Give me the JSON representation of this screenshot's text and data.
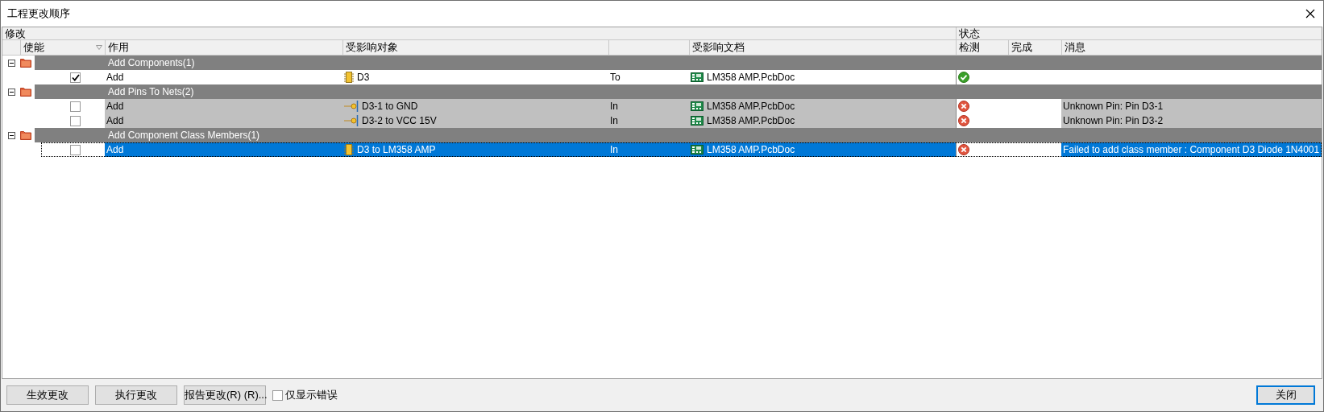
{
  "window": {
    "title": "工程更改顺序"
  },
  "header_groups": {
    "modify": "修改",
    "status": "状态"
  },
  "columns": {
    "enable": "使能",
    "action": "作用",
    "object": "受影响对象",
    "document": "受影响文档",
    "check": "检测",
    "done": "完成",
    "message": "消息"
  },
  "groups": [
    {
      "label": "Add Components(1)",
      "expanded": true,
      "items": [
        {
          "kind": "component",
          "enabled": true,
          "action": "Add",
          "object": "D3",
          "relation": "To",
          "document": "LM358 AMP.PcbDoc",
          "check_passed": true,
          "selected": false
        }
      ]
    },
    {
      "label": "Add Pins To Nets(2)",
      "expanded": true,
      "items": [
        {
          "kind": "pin",
          "enabled": false,
          "action": "Add",
          "object": "D3-1 to GND",
          "relation": "In",
          "document": "LM358 AMP.PcbDoc",
          "check_passed": false,
          "message": "Unknown Pin: Pin D3-1",
          "selected": false
        },
        {
          "kind": "pin",
          "enabled": false,
          "action": "Add",
          "object": "D3-2 to VCC 15V",
          "relation": "In",
          "document": "LM358 AMP.PcbDoc",
          "check_passed": false,
          "message": "Unknown Pin: Pin D3-2",
          "selected": false
        }
      ]
    },
    {
      "label": "Add Component Class Members(1)",
      "expanded": true,
      "items": [
        {
          "kind": "component",
          "enabled": false,
          "action": "Add",
          "object": "D3 to LM358 AMP",
          "relation": "In",
          "document": "LM358 AMP.PcbDoc",
          "check_passed": false,
          "message": "Failed to add class member : Component D3 Diode 1N4001",
          "selected": true
        }
      ]
    }
  ],
  "footer": {
    "buttons": [
      "生效更改",
      "执行更改",
      "报告更改(R) (R)..."
    ],
    "filter": {
      "label": "仅显示错误",
      "checked": false
    },
    "close_button": {
      "label": "关闭",
      "focused": true
    }
  }
}
